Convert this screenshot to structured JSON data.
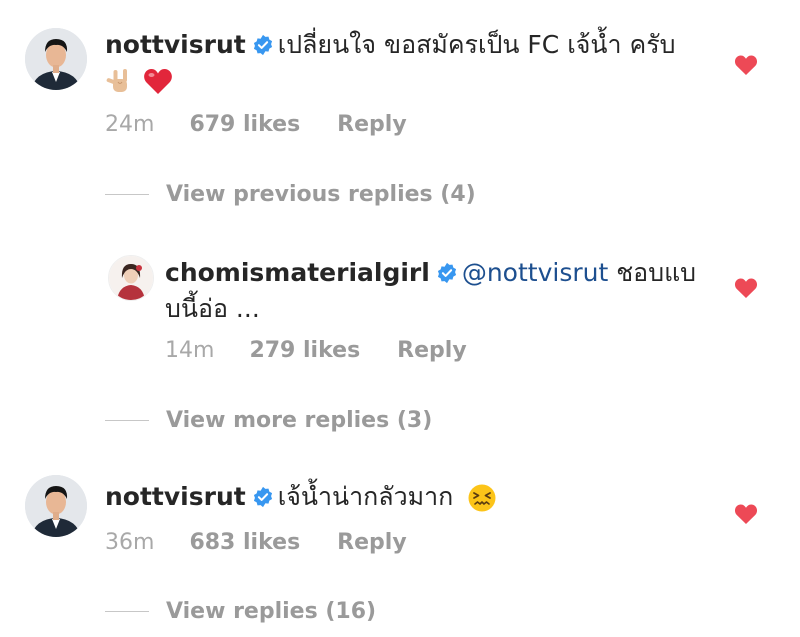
{
  "comments": [
    {
      "username": "nottvisrut",
      "text": "เปลี่ยนใจ ขอสมัครเป็น FC เจ้น้ำ ครับ",
      "emoji_1": "love-you-gesture-emoji",
      "emoji_2": "red-heart-emoji",
      "time": "24m",
      "likes": "679 likes",
      "reply_label": "Reply"
    },
    {
      "username": "chomismaterialgirl",
      "mention": "@nottvisrut",
      "text_line1": "ชอบแบ",
      "text_line2": "บนี้อ่อ ...",
      "time": "14m",
      "likes": "279 likes",
      "reply_label": "Reply"
    },
    {
      "username": "nottvisrut",
      "text": "เจ้น้ำน่ากลัวมาก",
      "emoji": "confounded-face-emoji",
      "time": "36m",
      "likes": "683 likes",
      "reply_label": "Reply"
    }
  ],
  "view_previous_replies": "View previous replies (4)",
  "view_more_replies": "View more replies (3)",
  "view_replies": "View replies (16)",
  "colors": {
    "heart": "#ed4956",
    "verified": "#3897f0",
    "mention": "#1d4f8f",
    "meta": "#a8a8a8"
  }
}
